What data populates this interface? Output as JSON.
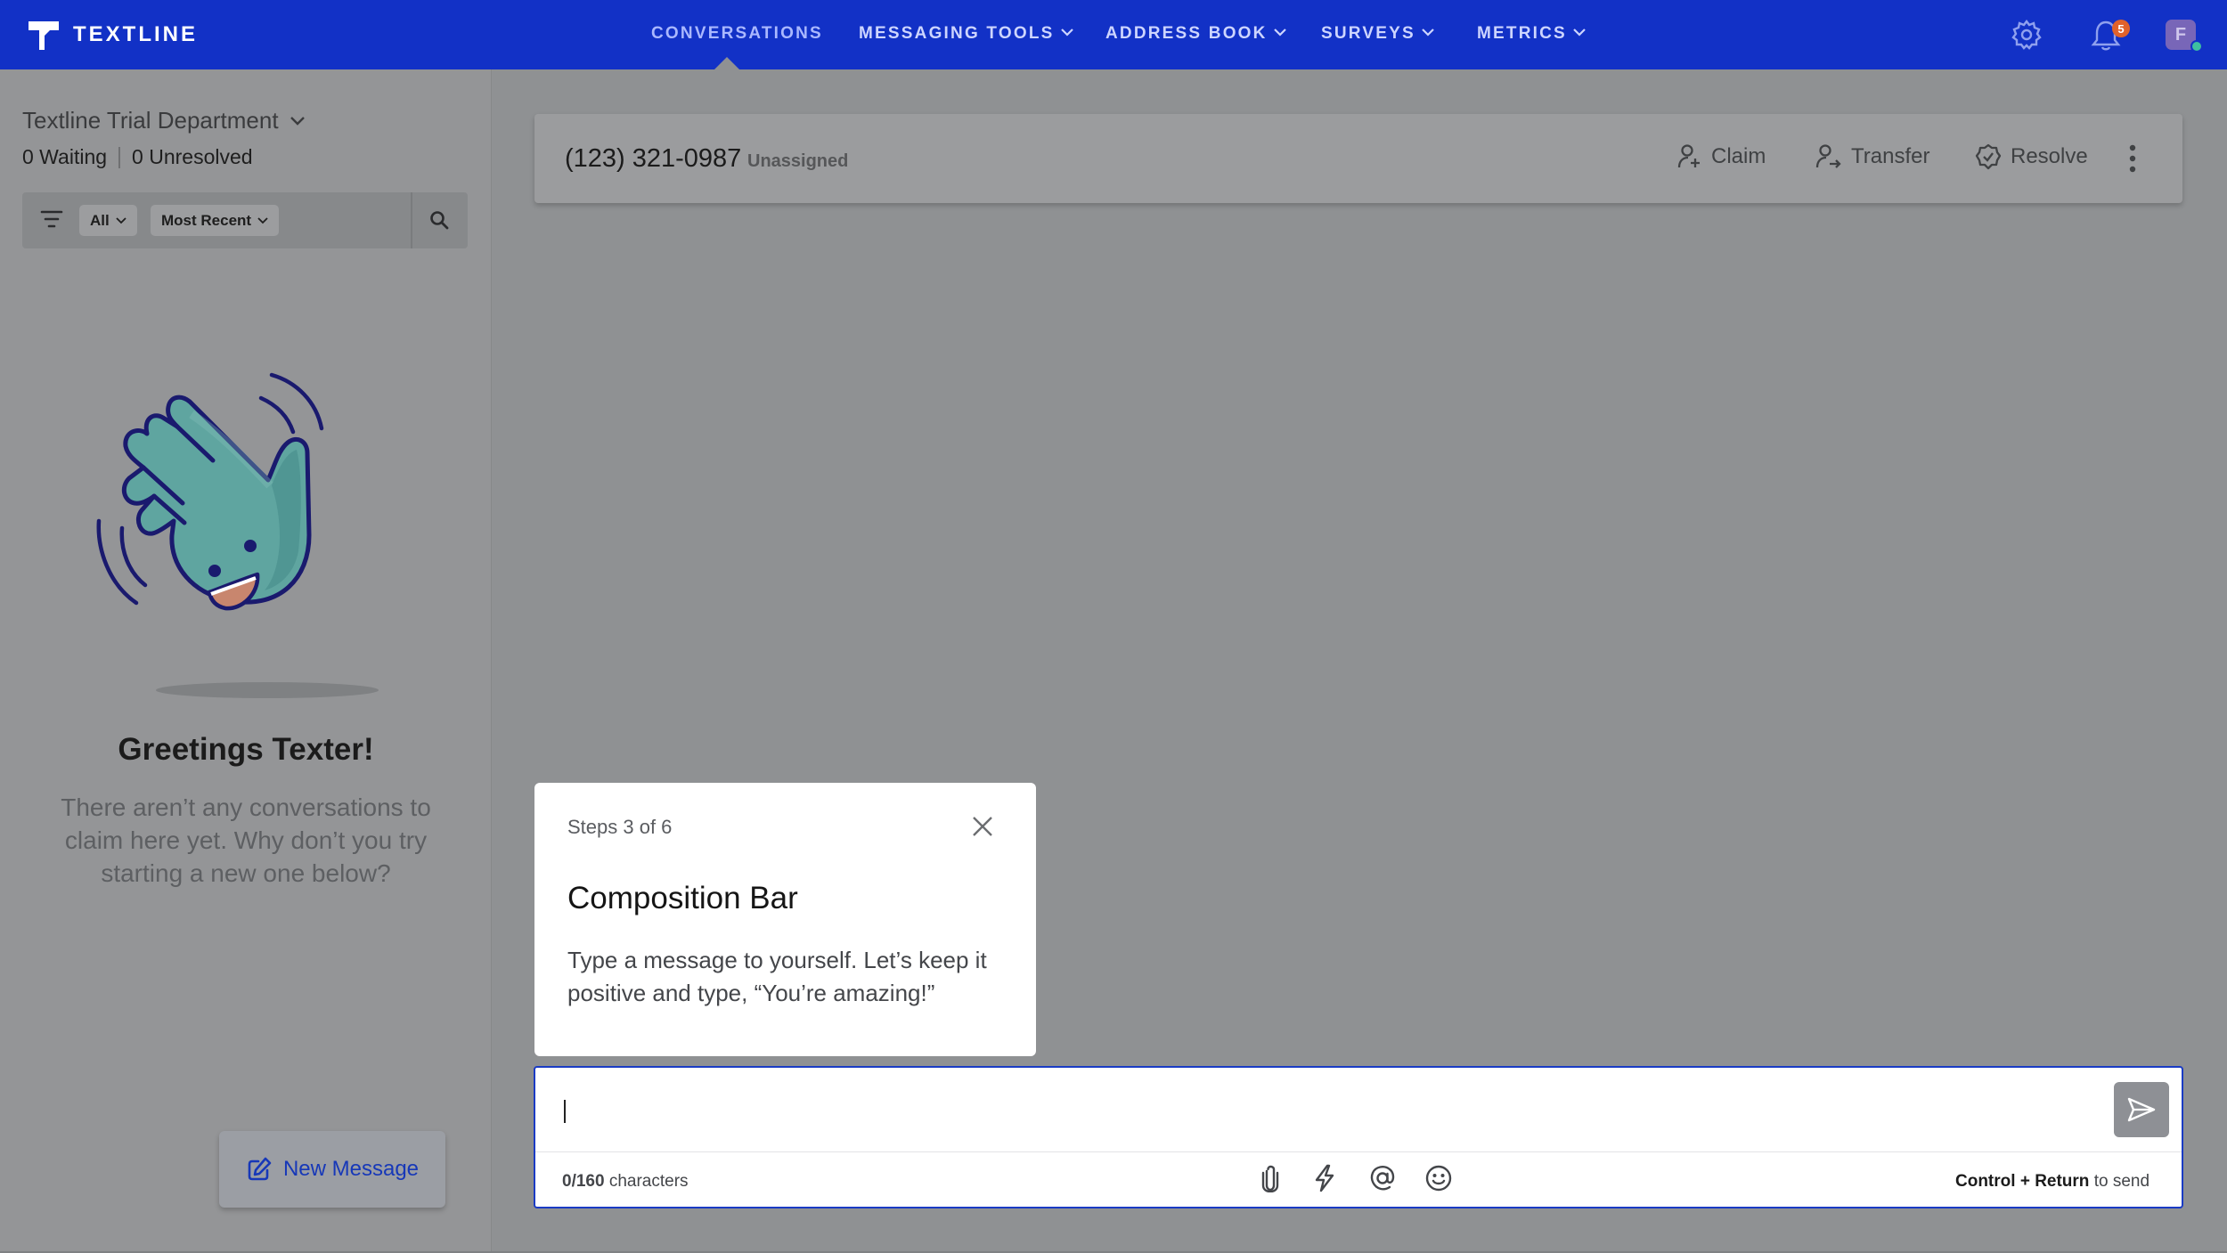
{
  "app": {
    "brand_name": "TEXTLINE"
  },
  "nav": {
    "conversations": "CONVERSATIONS",
    "messaging_tools": "MESSAGING TOOLS",
    "address_book": "ADDRESS BOOK",
    "surveys": "SURVEYS",
    "metrics": "METRICS",
    "notification_count": "5",
    "avatar_initial": "F"
  },
  "sidebar": {
    "department": "Textline Trial Department",
    "waiting": "0 Waiting",
    "unresolved": "0 Unresolved",
    "filter_all": "All",
    "sort": "Most Recent",
    "greeting": "Greetings Texter!",
    "empty_message": "There aren’t any conversations to claim here yet. Why don’t you try starting a new one below?",
    "new_message": "New Message"
  },
  "conversation": {
    "phone": "(123) 321-0987",
    "assignment": "Unassigned",
    "claim": "Claim",
    "transfer": "Transfer",
    "resolve": "Resolve"
  },
  "tooltip": {
    "steps": "Steps 3 of 6",
    "title": "Composition Bar",
    "body": "Type a message to yourself. Let’s keep it positive and type, “You’re amazing!”"
  },
  "composer": {
    "value": "",
    "char_used": "0/160",
    "char_suffix": "characters",
    "hint_keys": "Control + Return",
    "hint_suffix": "to send"
  },
  "icons": [
    "textline-logo-icon",
    "chevron-down-icon",
    "gear-icon",
    "bell-icon",
    "filter-icon",
    "search-icon",
    "waving-hand-illustration",
    "compose-icon",
    "person-add-icon",
    "transfer-icon",
    "check-badge-icon",
    "more-vertical-icon",
    "close-icon",
    "send-icon",
    "paperclip-icon",
    "lightning-icon",
    "at-icon",
    "emoji-icon"
  ],
  "colors": {
    "nav_bg": "#1231c6",
    "overlay": "#8f9193",
    "accent_blue": "#1a3bc4",
    "badge": "#e0622b",
    "hand_teal": "#5fa5a0",
    "hand_outline": "#1a1a6e"
  }
}
